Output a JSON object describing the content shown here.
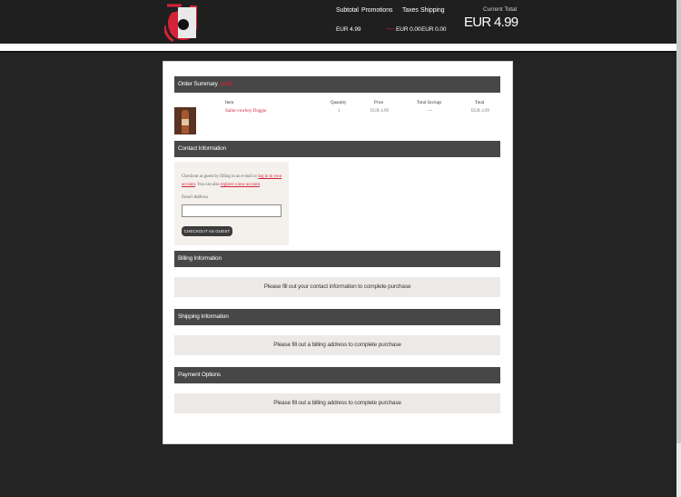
{
  "header": {
    "subtotal_label": "Subtotal",
    "promotions_label": "Promotions",
    "taxes_label": "Taxes",
    "shipping_label": "Shipping",
    "subtotal_value": "EUR 4.99",
    "promotions_value": "—",
    "taxes_value": "EUR 0.00",
    "shipping_value": "EUR 0.00",
    "current_total_label": "Current Total",
    "current_total_value": "EUR 4.99"
  },
  "colors": {
    "accent": "#d52238",
    "section_bar": "#474747",
    "background": "#242424"
  },
  "order_summary": {
    "title": "Order Summary",
    "edit_label": "(edit)",
    "columns": [
      "Item",
      "Quantity",
      "Price",
      "Total Savings",
      "Total"
    ],
    "rows": [
      {
        "item": "Sailor-cowboy Doggie",
        "quantity": "1",
        "price": "EUR 4.99",
        "savings": "---",
        "total": "EUR 4.99"
      }
    ]
  },
  "contact": {
    "title": "Contact Information",
    "text_before_login": "Checkout as guest by filling in an e-mail or",
    "login_link": "log in to your account",
    "text_mid": ". You can also",
    "register_link": "register a new account",
    "text_end": ".",
    "email_label": "Email Address",
    "email_value": "",
    "guest_button": "CHECKOUT AS GUEST"
  },
  "billing": {
    "title": "Billing Information",
    "message": "Please fill out your contact information to complete purchase"
  },
  "shipping": {
    "title": "Shipping Information",
    "message": "Please fill out a billing address to complete purchase"
  },
  "payment": {
    "title": "Payment Options",
    "message": "Please fill out a billing address to complete purchase"
  }
}
